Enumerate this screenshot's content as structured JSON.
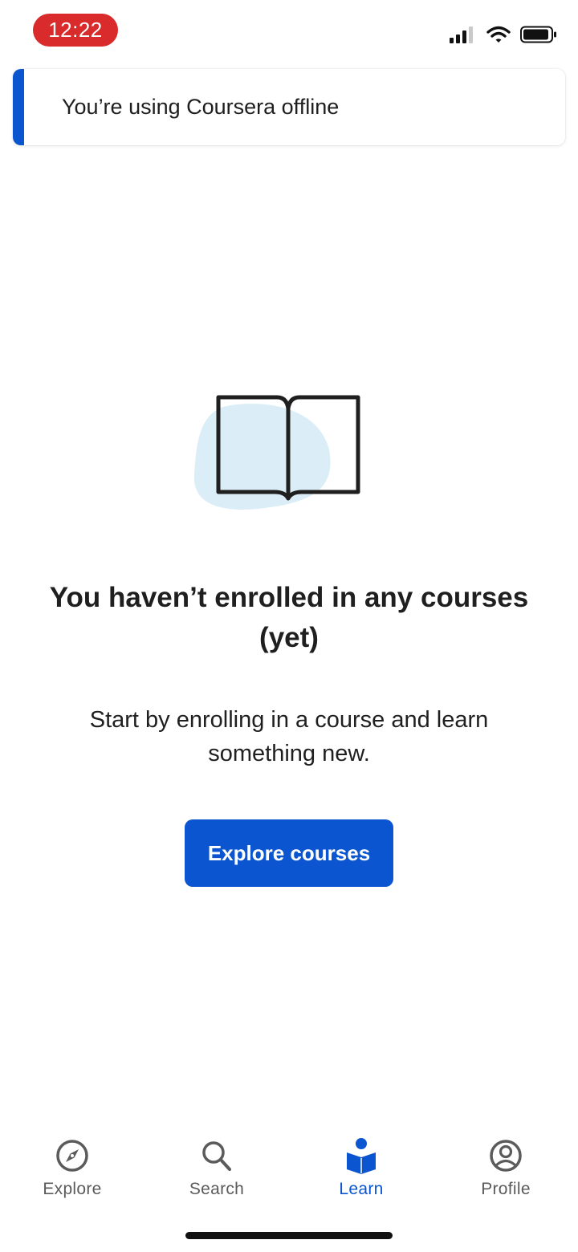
{
  "status_bar": {
    "time": "12:22"
  },
  "offline_banner": {
    "message": "You’re using Coursera offline"
  },
  "empty_state": {
    "title": "You haven’t enrolled in any courses (yet)",
    "subtitle": "Start by enrolling in a course and learn something new.",
    "cta_label": "Explore courses",
    "illustration_icon": "open-book-icon"
  },
  "bottom_nav": {
    "items": [
      {
        "label": "Explore",
        "icon": "compass-icon",
        "active": false
      },
      {
        "label": "Search",
        "icon": "search-icon",
        "active": false
      },
      {
        "label": "Learn",
        "icon": "learn-icon",
        "active": true
      },
      {
        "label": "Profile",
        "icon": "profile-icon",
        "active": false
      }
    ]
  },
  "colors": {
    "brand_blue": "#0b56d0",
    "time_pill": "#d92b2b",
    "illustration_blob": "#dbeef7",
    "inactive_nav": "#5b5b5b"
  }
}
